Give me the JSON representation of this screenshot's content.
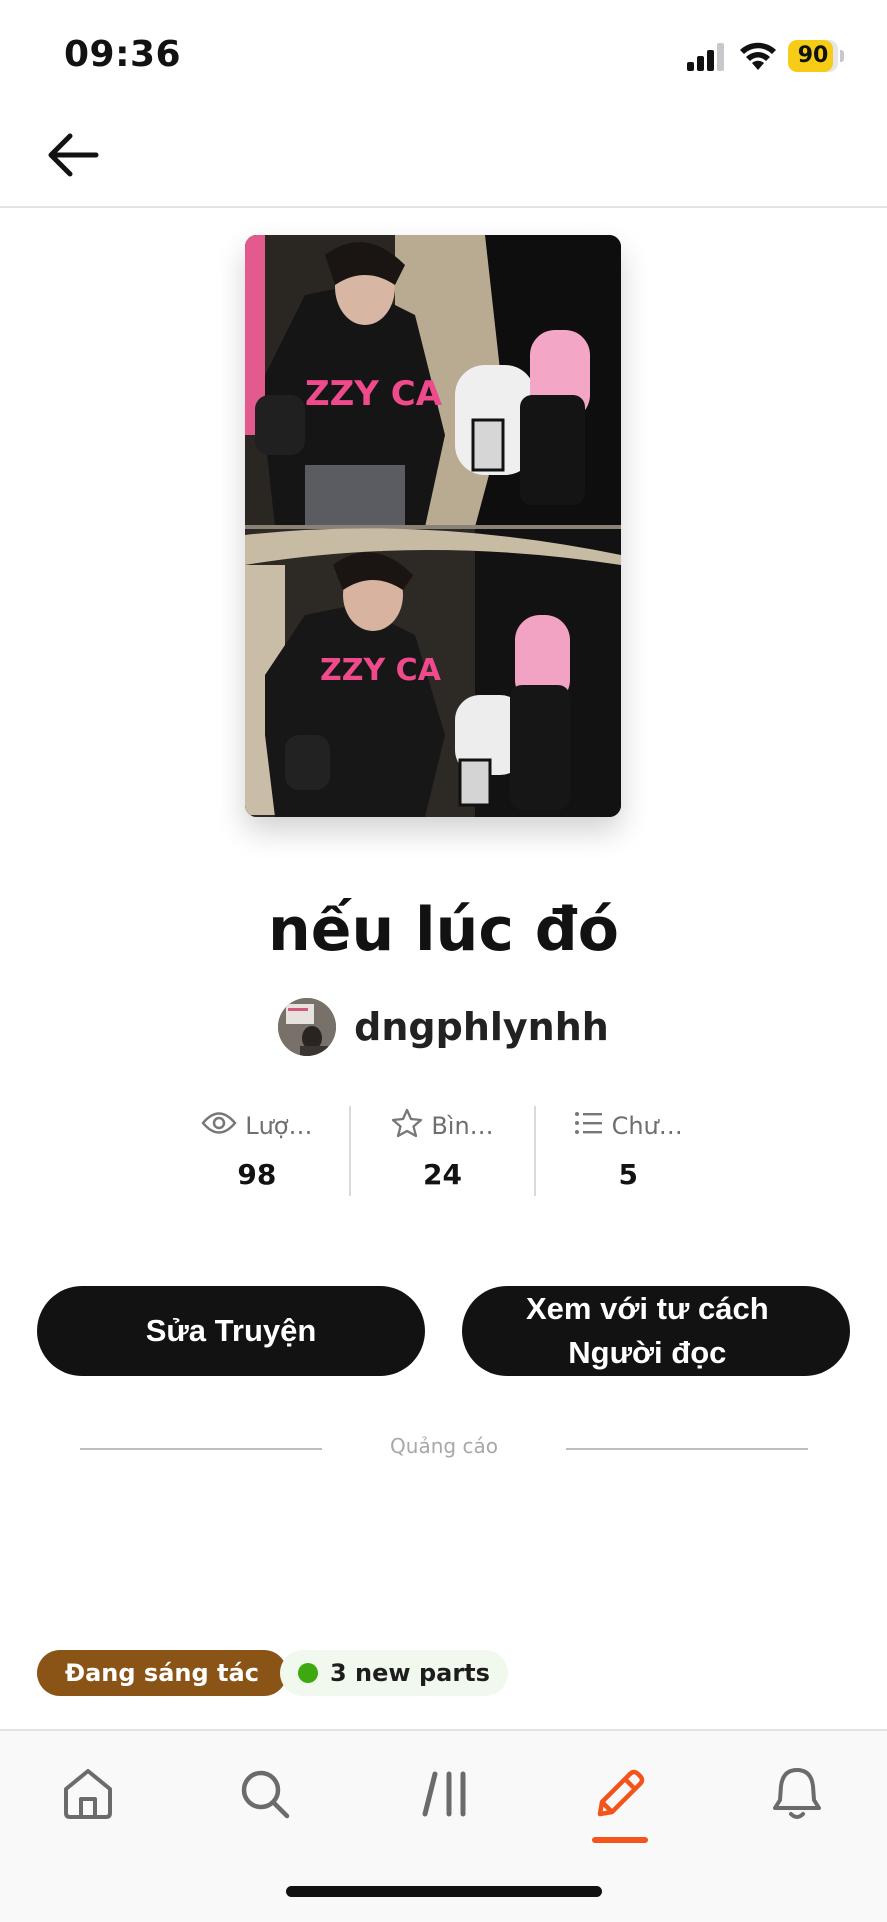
{
  "status_bar": {
    "time": "09:36",
    "battery_level": "90",
    "battery_color": "#f7cc17",
    "icons": [
      "signal-icon",
      "wifi-icon",
      "battery-icon"
    ]
  },
  "header": {
    "back_icon": "arrow-left-icon"
  },
  "story": {
    "title": "nếu lúc đó",
    "author": "dngphlynhh"
  },
  "stats": [
    {
      "icon": "eye-icon",
      "label": "Lượ…",
      "value": "98"
    },
    {
      "icon": "star-icon",
      "label": "Bìn…",
      "value": "24"
    },
    {
      "icon": "list-icon",
      "label": "Chư…",
      "value": "5"
    }
  ],
  "actions": {
    "edit_label": "Sửa Truyện",
    "reader_label_line1": "Xem với tư cách",
    "reader_label_line2": "Người đọc"
  },
  "ad": {
    "label": "Quảng cáo"
  },
  "tags": {
    "status": "Đang sáng tác",
    "status_color": "#8a5417",
    "new_parts": "3 new parts",
    "new_parts_dot_color": "#3da80f"
  },
  "bottom_nav": {
    "items": [
      {
        "icon": "home-icon",
        "active": false
      },
      {
        "icon": "search-icon",
        "active": false
      },
      {
        "icon": "library-icon",
        "active": false
      },
      {
        "icon": "pencil-icon",
        "active": true
      },
      {
        "icon": "bell-icon",
        "active": false
      }
    ],
    "active_color": "#f2541b"
  }
}
